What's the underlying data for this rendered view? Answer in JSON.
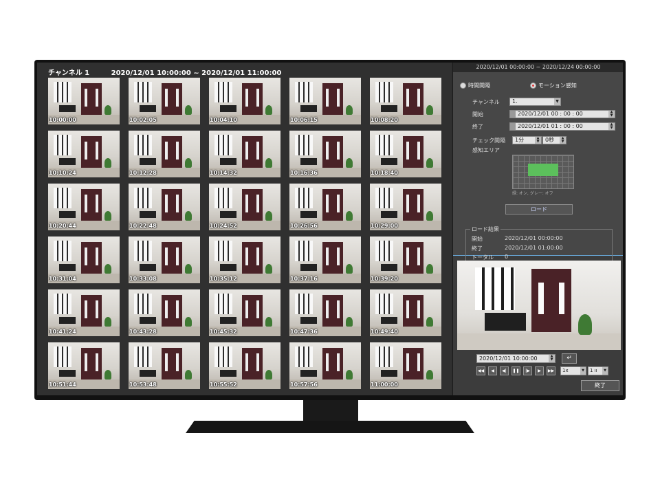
{
  "header": {
    "channel": "チャンネル 1",
    "range": "2020/12/01  10:00:00 ~ 2020/12/01  11:00:00"
  },
  "thumbnails": [
    "10:00:00",
    "10:02:05",
    "10:04:10",
    "10:06:15",
    "10:08:20",
    "10:10:24",
    "10:12:28",
    "10:14:32",
    "10:16:36",
    "10:18:40",
    "10:20:44",
    "10:22:48",
    "10:24:52",
    "10:26:56",
    "10:29:00",
    "10:31:04",
    "10:33:08",
    "10:35:12",
    "10:37:16",
    "10:39:20",
    "10:41:24",
    "10:43:28",
    "10:45:32",
    "10:47:36",
    "10:49:40",
    "10:51:44",
    "10:53:48",
    "10:55:52",
    "10:57:56",
    "11:00:00"
  ],
  "panel": {
    "top_range": "2020/12/01  00:00:00 ~ 2020/12/24  00:00:00",
    "mode_time": "時間間隔",
    "mode_motion": "モーション感知",
    "channel_label": "チャンネル",
    "channel_value": "1.",
    "start_label": "開始",
    "start_value": "2020/12/01  00 : 00 : 00",
    "end_label": "終了",
    "end_value": "2020/12/01  01 : 00 : 00",
    "interval_label": "チェック間隔",
    "interval_min": "1分",
    "interval_sec": "0秒",
    "area_label": "感知エリア",
    "area_note": "緑: オン, グレー: オフ",
    "load_button": "ロード",
    "result_title": "ロード結果",
    "result_start_label": "開始",
    "result_start_value": "2020/12/01  00:00:00",
    "result_end_label": "終了",
    "result_end_value": "2020/12/01  01:00:00",
    "result_total_label": "トータル",
    "result_total_value": "0"
  },
  "playback": {
    "time": "2020/12/01  10:00:00",
    "go_icon": "↵",
    "controls": [
      "◀◀",
      "◀",
      "◀|",
      "❚❚",
      "|▶",
      "▶",
      "▶▶"
    ],
    "speed": "1x",
    "step": "1 ıı",
    "end_button": "終了"
  }
}
